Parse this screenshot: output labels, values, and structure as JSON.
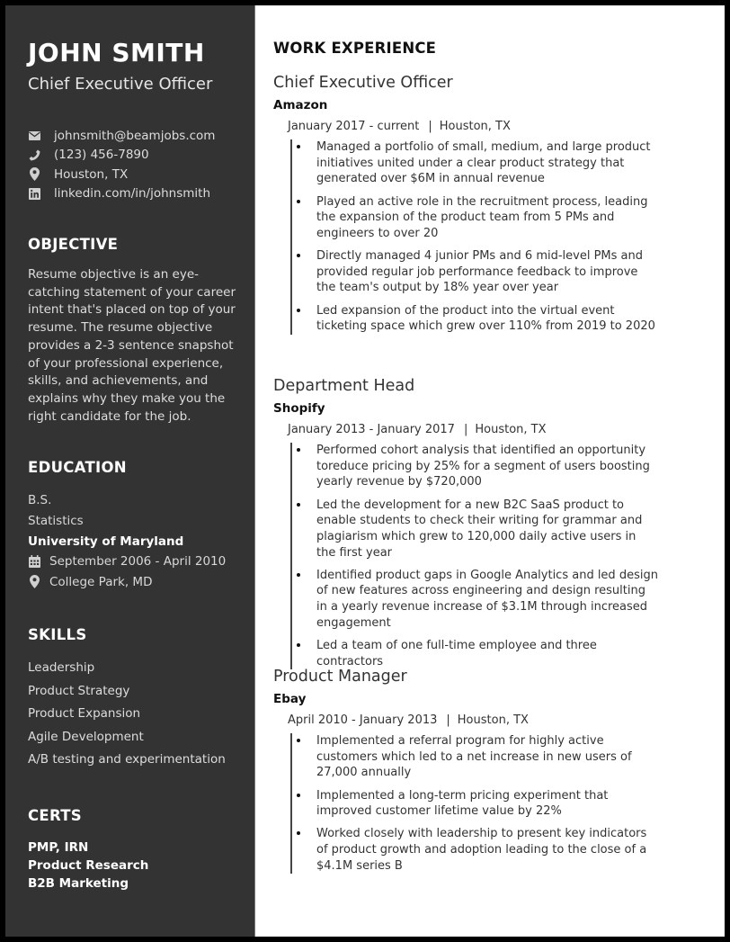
{
  "sidebar": {
    "name": "JOHN SMITH",
    "title": "Chief Executive Officer",
    "contacts": [
      {
        "icon": "envelope-icon",
        "text": "johnsmith@beamjobs.com"
      },
      {
        "icon": "phone-icon",
        "text": "(123) 456-7890"
      },
      {
        "icon": "map-pin-icon",
        "text": "Houston, TX"
      },
      {
        "icon": "linkedin-icon",
        "text": "linkedin.com/in/johnsmith"
      }
    ],
    "objective": {
      "heading": "OBJECTIVE",
      "text": "Resume objective is an eye-catching statement of your career intent that's placed on top of your resume. The resume objective provides a 2-3 sentence snapshot of your professional experience, skills, and achievements, and explains why they make you the right candidate for the job."
    },
    "education": {
      "heading": "EDUCATION",
      "degree": "B.S.",
      "field": "Statistics",
      "school": "University of Maryland",
      "dates": "September 2006 - April 2010",
      "location": "College Park, MD"
    },
    "skills": {
      "heading": "SKILLS",
      "items": [
        "Leadership",
        "Product Strategy",
        "Product Expansion",
        "Agile Development",
        "A/B testing and experimentation"
      ]
    },
    "certs": {
      "heading": "CERTS",
      "items": [
        "PMP, IRN",
        "Product Research",
        "B2B Marketing"
      ]
    }
  },
  "main": {
    "heading": "WORK EXPERIENCE",
    "jobs": [
      {
        "title": "Chief Executive Officer",
        "company": "Amazon",
        "dates": "January 2017 - current",
        "location": "Houston, TX",
        "bullets": [
          "Managed a portfolio of small, medium, and large product initiatives united under a clear product strategy that generated over $6M in annual revenue",
          "Played an active role in the recruitment process, leading the expansion of the product team from 5 PMs and engineers to over 20",
          "Directly managed 4 junior PMs and 6 mid-level PMs and provided regular job performance feedback to improve the team's output by 18% year over year",
          "Led expansion of the product into the virtual event ticketing space which grew over 110% from 2019 to 2020"
        ]
      },
      {
        "title": "Department Head",
        "company": "Shopify",
        "dates": "January 2013 - January 2017",
        "location": "Houston, TX",
        "bullets": [
          "Performed cohort analysis that identified an opportunity toreduce pricing by 25% for a segment of users boosting yearly revenue by $720,000",
          "Led the development for a new B2C SaaS product to enable students to check their writing for grammar and plagiarism which grew to 120,000 daily active users in the first year",
          "Identified product gaps in Google Analytics and led design of new features across engineering and design resulting in a yearly revenue increase of $3.1M through increased engagement",
          "Led a team of one full-time employee and three contractors"
        ]
      },
      {
        "title": "Product Manager",
        "company": "Ebay",
        "dates": "April 2010 - January 2013",
        "location": "Houston, TX",
        "bullets": [
          "Implemented a referral program for highly active customers which led to a net increase in new users of 27,000 annually",
          "Implemented a long-term pricing experiment that improved customer lifetime value by 22%",
          "Worked closely with leadership to present key indicators of product growth and adoption leading to the close of a $4.1M series B"
        ]
      }
    ],
    "separator": "|"
  }
}
